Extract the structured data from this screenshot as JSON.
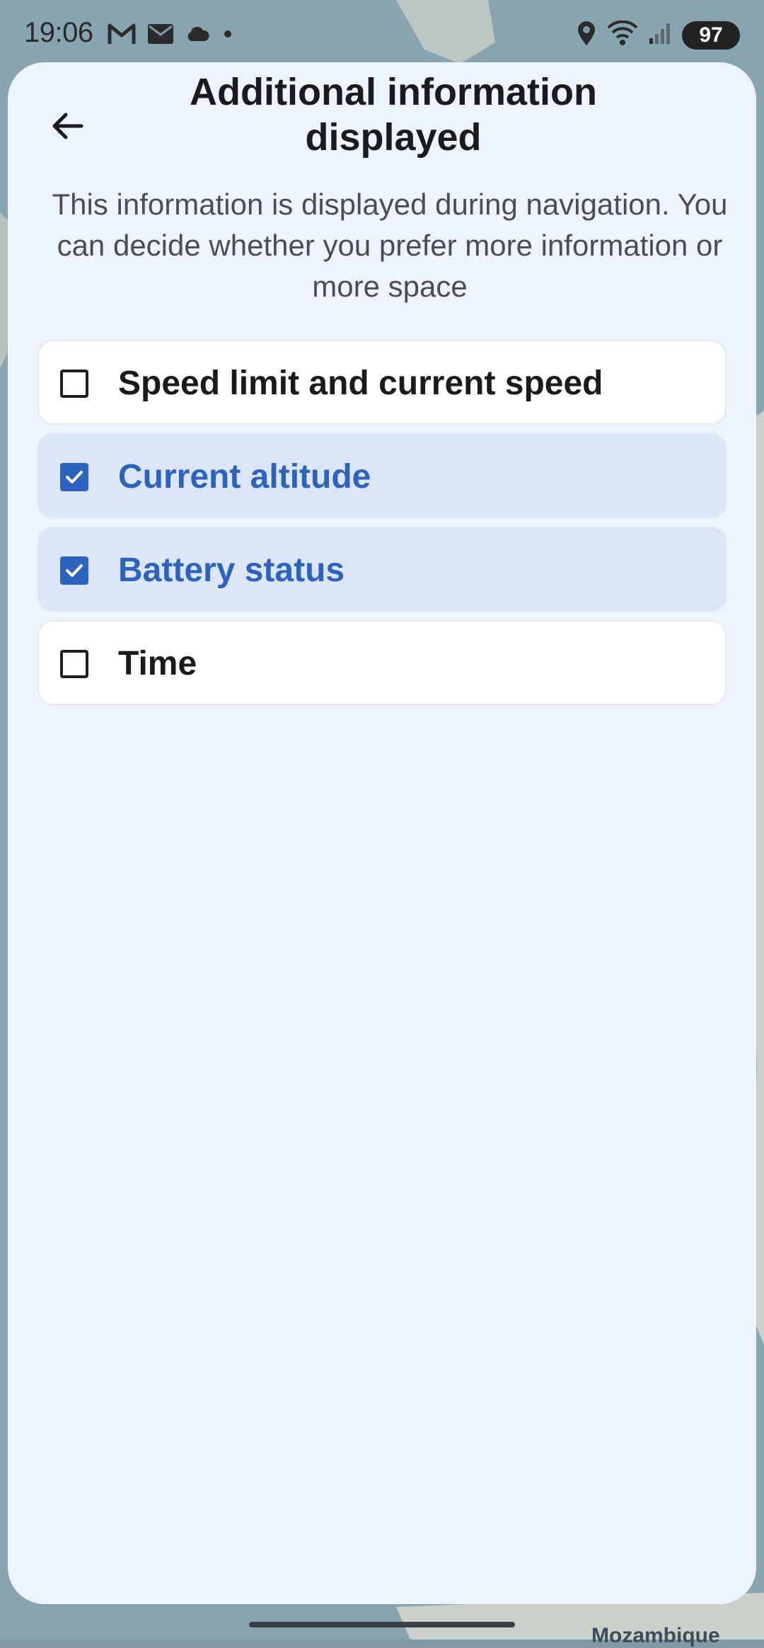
{
  "status_bar": {
    "time": "19:06",
    "battery": "97",
    "left_icons": [
      "gmail-icon",
      "mail-icon",
      "cloud-icon",
      "dot-icon"
    ],
    "right_icons": [
      "location-icon",
      "wifi-icon",
      "signal-icon"
    ]
  },
  "sheet": {
    "title": "Additional information displayed",
    "description": "This information is displayed during navigation. You can decide whether you prefer more information or more space",
    "back_icon": "arrow-back-icon"
  },
  "options": [
    {
      "label": "Speed limit and current speed",
      "checked": false
    },
    {
      "label": "Current altitude",
      "checked": true
    },
    {
      "label": "Battery status",
      "checked": true
    },
    {
      "label": "Time",
      "checked": false
    }
  ],
  "map": {
    "label": "Mozambique"
  },
  "colors": {
    "accent": "#2e62bf",
    "sheet_bg": "#eef4ff",
    "checked_bg": "#dbe6f8"
  }
}
